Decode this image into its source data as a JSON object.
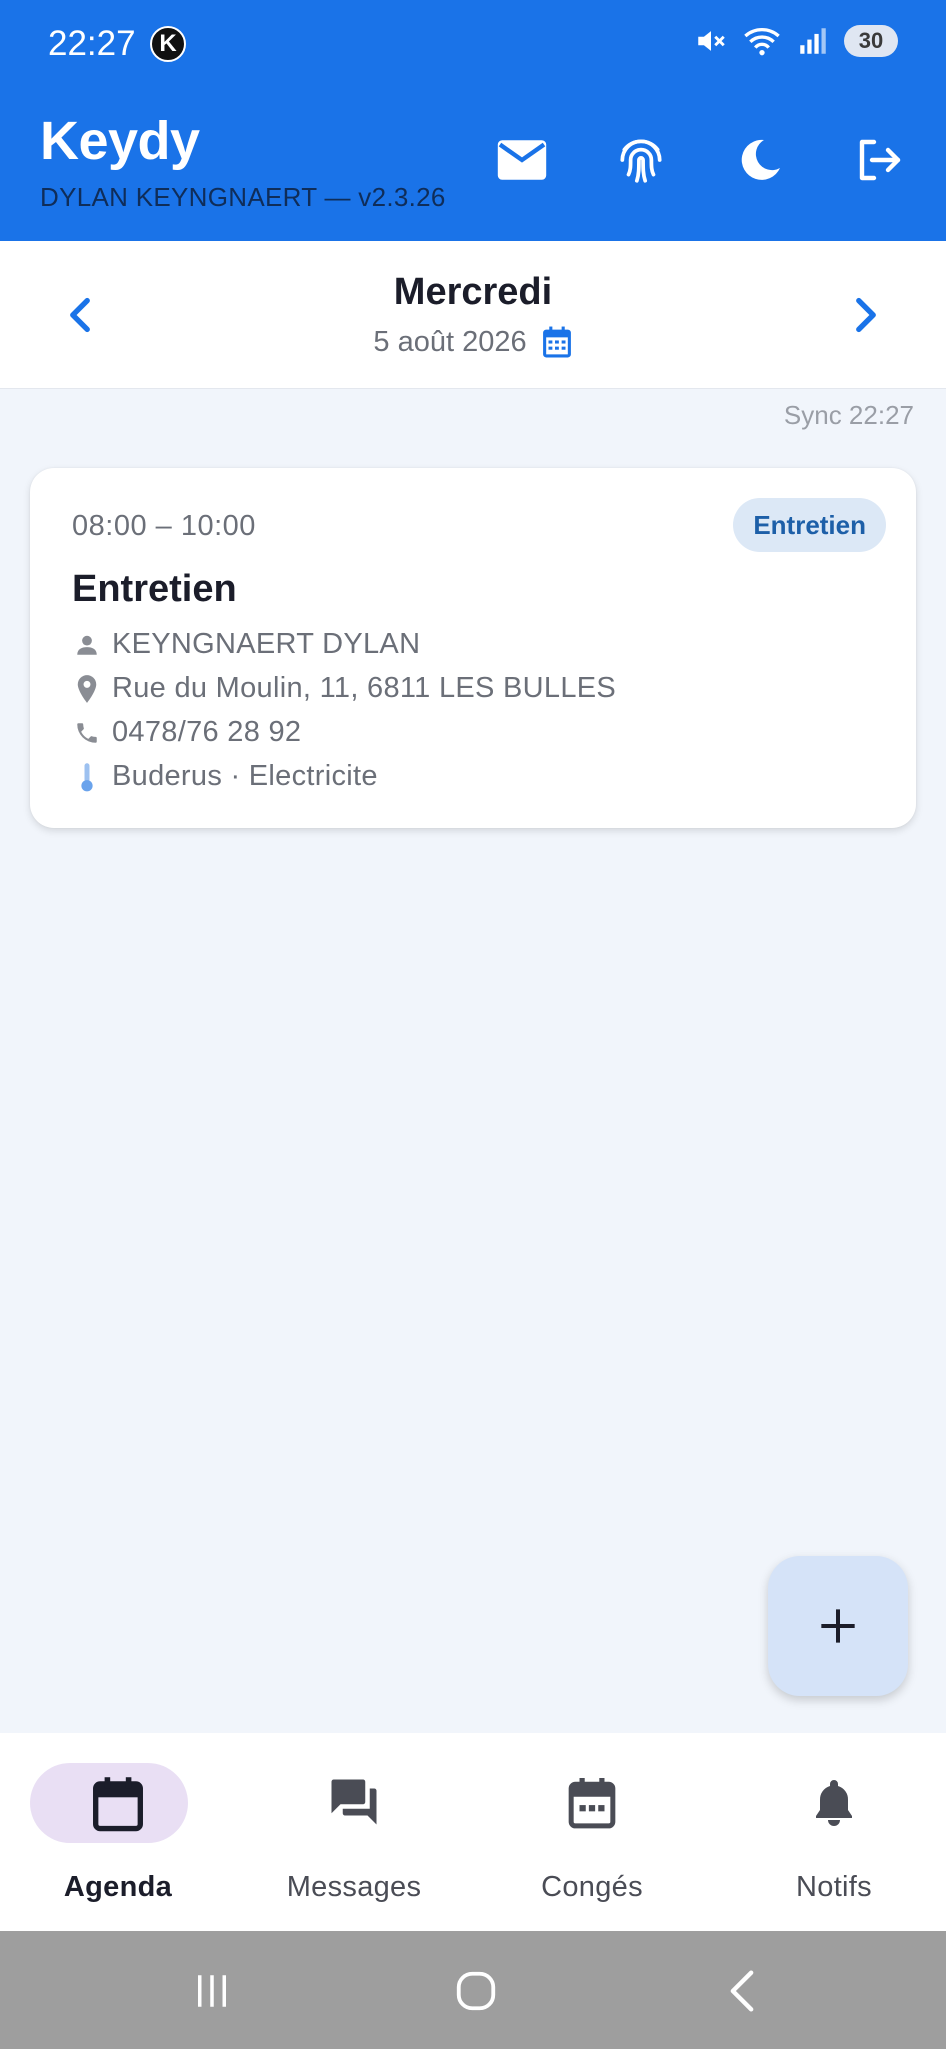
{
  "status_bar": {
    "time": "22:27",
    "app_badge": "K",
    "battery": "30"
  },
  "header": {
    "title": "Keydy",
    "subtitle": "DYLAN KEYNGNAERT — v2.3.26",
    "actions": [
      "mail-icon",
      "fingerprint-icon",
      "dark-mode-icon",
      "logout-icon"
    ]
  },
  "date_nav": {
    "day": "Mercredi",
    "date": "5 août 2026"
  },
  "sync": "Sync 22:27",
  "appointment": {
    "time": "08:00 – 10:00",
    "badge": "Entretien",
    "title": "Entretien",
    "client": "KEYNGNAERT DYLAN",
    "address": "Rue du Moulin, 11, 6811 LES BULLES",
    "phone": "0478/76 28 92",
    "equipment": "Buderus · Electricite"
  },
  "fab": {
    "icon": "plus-icon"
  },
  "bottom_nav": [
    {
      "label": "Agenda",
      "icon": "calendar-icon",
      "active": true
    },
    {
      "label": "Messages",
      "icon": "forum-icon",
      "active": false
    },
    {
      "label": "Congés",
      "icon": "calendar-dots-icon",
      "active": false
    },
    {
      "label": "Notifs",
      "icon": "bell-icon",
      "active": false
    }
  ],
  "colors": {
    "primary": "#1a73e8",
    "badge_bg": "#dce8f6",
    "badge_text": "#1d5fa8",
    "active_pill": "#e9dff4",
    "background": "#f1f5fb"
  }
}
